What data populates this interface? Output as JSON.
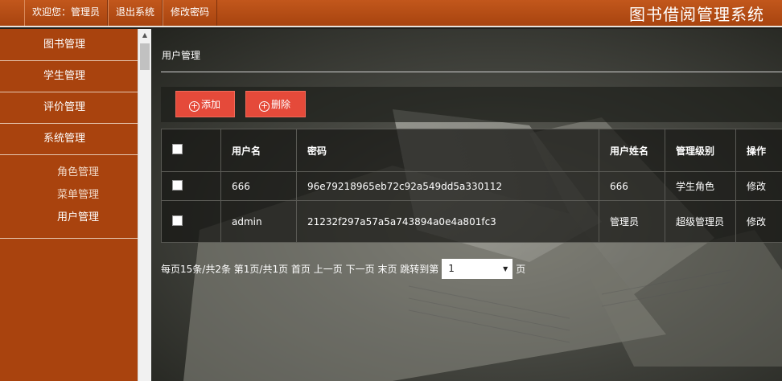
{
  "topbar": {
    "welcome": "欢迎您：管理员",
    "logout": "退出系统",
    "change_password": "修改密码",
    "brand": "图书借阅管理系统"
  },
  "sidebar": {
    "items": [
      {
        "label": "图书管理"
      },
      {
        "label": "学生管理"
      },
      {
        "label": "评价管理"
      },
      {
        "label": "系统管理"
      }
    ],
    "subitems": [
      {
        "label": "角色管理"
      },
      {
        "label": "菜单管理"
      },
      {
        "label": "用户管理",
        "active": true
      }
    ]
  },
  "main": {
    "title": "用户管理",
    "add_label": "添加",
    "delete_label": "删除",
    "add_icon": "plus-circle-icon",
    "delete_icon": "plus-circle-icon",
    "table": {
      "headers": [
        "用户名",
        "密码",
        "用户姓名",
        "管理级别",
        "操作"
      ],
      "rows": [
        {
          "username": "666",
          "password": "96e79218965eb72c92a549dd5a330112",
          "name": "666",
          "level": "学生角色",
          "action": "修改"
        },
        {
          "username": "admin",
          "password": "21232f297a57a5a743894a0e4a801fc3",
          "name": "管理员",
          "level": "超级管理员",
          "action": "修改"
        }
      ]
    },
    "pager": {
      "summary": "每页15条/共2条 第1页/共1页",
      "first": "首页",
      "prev": "上一页",
      "next": "下一页",
      "last": "末页",
      "jump_label": "跳转到第",
      "page_value": "1",
      "page_suffix": "页"
    }
  },
  "colors": {
    "header_bg": "#b54b14",
    "sidebar_bg": "#a9430e",
    "button_bg": "#e54a3a"
  }
}
